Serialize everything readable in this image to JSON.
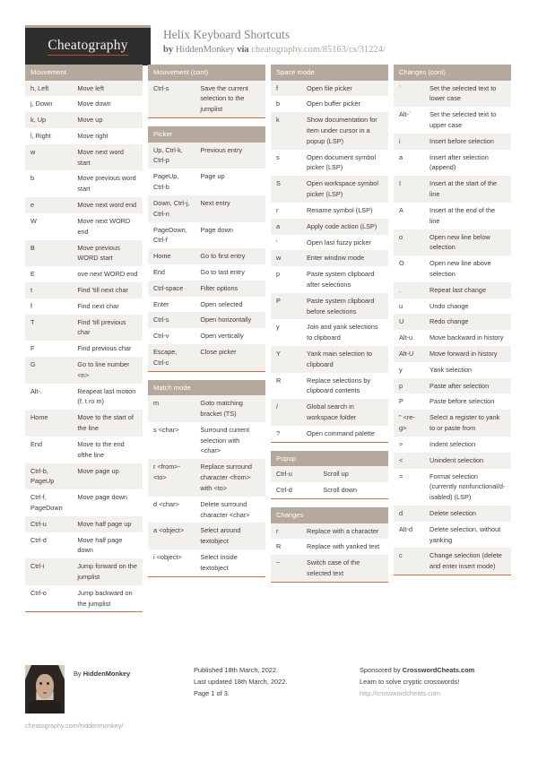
{
  "header": {
    "logo_text": "Cheatography",
    "title": "Helix Keyboard Shortcuts",
    "by_label": "by",
    "author": "HiddenMonkey",
    "via_label": "via",
    "source_url": "cheatography.com/85163/cs/31224/"
  },
  "columns": [
    {
      "blocks": [
        {
          "title": "Mouvement",
          "narrow_key": false,
          "rows": [
            [
              "h, Left",
              "Move left"
            ],
            [
              "j, Down",
              "Move down"
            ],
            [
              "k, Up",
              "Move up"
            ],
            [
              "l, Right",
              "Move right"
            ],
            [
              "w",
              "Move next word start"
            ],
            [
              "b",
              "Move previous word start"
            ],
            [
              "e",
              "Move next word end"
            ],
            [
              "W",
              "Move next WORD end"
            ],
            [
              "B",
              "Move previous WORD start"
            ],
            [
              "E",
              "ove next WORD end"
            ],
            [
              "t",
              "Find 'till next char"
            ],
            [
              "f",
              "Find next char"
            ],
            [
              "T",
              "Find 'till previous char"
            ],
            [
              "F",
              "Find previous char"
            ],
            [
              "G",
              "Go to line number <n>"
            ],
            [
              "Alt-.",
              "Reapeat last motion (f, t ro m)"
            ],
            [
              "Home",
              "Move to the start of the line"
            ],
            [
              "End",
              "Move to the end ofthe line"
            ],
            [
              "Ctrl-b, PageUp",
              "Move page up"
            ],
            [
              "Ctrl-f, PageDown",
              "Move page down"
            ],
            [
              "Ctrl-u",
              "Move half page up"
            ],
            [
              "Ctrl-d",
              "Move half page down"
            ],
            [
              "Ctrl-i",
              "Jump forward on the jumplist"
            ],
            [
              "Ctrl-o",
              "Jump backward on the jumplist"
            ]
          ]
        }
      ]
    },
    {
      "blocks": [
        {
          "title": "Mouvement (cont)",
          "narrow_key": false,
          "rows": [
            [
              "Ctrl-s",
              "Save the current selection to the jumplist"
            ]
          ]
        },
        {
          "title": "Picker",
          "narrow_key": false,
          "rows": [
            [
              "Up, Ctrl-k, Ctrl-p",
              "Previous entry"
            ],
            [
              "PageUp, Ctrl-b",
              "Page up"
            ],
            [
              "Down, Ctrl-j, Ctrl-n",
              "Next entry"
            ],
            [
              "PageDown, Ctrl-f",
              "Page down"
            ],
            [
              "Home",
              "Go to first entry"
            ],
            [
              "End",
              "Go to last entry"
            ],
            [
              "Ctrl-space",
              "Filter options"
            ],
            [
              "Enter",
              "Open selected"
            ],
            [
              "Ctrl-s",
              "Open horizo­ntally"
            ],
            [
              "Ctrl-v",
              "Open vertically"
            ],
            [
              "Escape, Ctrl-c",
              "Close picker"
            ]
          ]
        },
        {
          "title": "Match mode",
          "narrow_key": false,
          "rows": [
            [
              "m",
              "Goto matching bracket (TS)"
            ],
            [
              "s <ch­ar>",
              "Surround current selection with <char>"
            ],
            [
              "r <fr­om>-<to>",
              "Replace surround character <from> with <to>"
            ],
            [
              "d <ch­ar>",
              "Delete surround character <char>"
            ],
            [
              "a <ob­ject>",
              "Select around textobject"
            ],
            [
              "i <ob­ject>",
              "Select inside textobject"
            ]
          ]
        }
      ]
    },
    {
      "blocks": [
        {
          "title": "Space mode",
          "narrow_key": true,
          "rows": [
            [
              "f",
              "Open file picker"
            ],
            [
              "b",
              "Open buffer picker"
            ],
            [
              "k",
              "Show documentation for item under cursor in a popup (LSP)"
            ],
            [
              "s",
              "Open document symbol picker (LSP)"
            ],
            [
              "S",
              "Open workspace symbol picker (LSP)"
            ],
            [
              "r",
              "Rename symbol (LSP)"
            ],
            [
              "a",
              "Apply code action (LSP)"
            ],
            [
              "'",
              "Open last fuzzy picker"
            ],
            [
              "w",
              "Enter window mode"
            ],
            [
              "p",
              "Paste system clipboard after selections"
            ],
            [
              "P",
              "Paste system clipboard before selections"
            ],
            [
              "y",
              "Join and yank selections to clipboard"
            ],
            [
              "Y",
              "Yank main selection to clipboard"
            ],
            [
              "R",
              "Replace selections by clipboard contents"
            ],
            [
              "/",
              "Global search in workspace folder"
            ],
            [
              "?",
              "Open command palette"
            ]
          ]
        },
        {
          "title": "Popup",
          "narrow_key": false,
          "rows": [
            [
              "Ctrl-u",
              "Scroll up"
            ],
            [
              "Ctrl-d",
              "Scroll down"
            ]
          ]
        },
        {
          "title": "Changes",
          "narrow_key": true,
          "rows": [
            [
              "r",
              "Replace with a character"
            ],
            [
              "R",
              "Replace with yanked text"
            ],
            [
              "~",
              "Switch case of the selected text"
            ]
          ]
        }
      ]
    },
    {
      "blocks": [
        {
          "title": "Changes (cont)",
          "narrow_key": true,
          "rows": [
            [
              "`",
              "Set the selected text to lower case"
            ],
            [
              "Alt-`",
              "Set the selected text to upper case"
            ],
            [
              "i",
              "Insert before selection"
            ],
            [
              "a",
              "Insert after selection (append)"
            ],
            [
              "I",
              "Insert at the start of the line"
            ],
            [
              "A",
              "Insert at the end of the line"
            ],
            [
              "o",
              "Open new line below selection"
            ],
            [
              "O",
              "Open new line above selection"
            ],
            [
              ".",
              "Repeat last change"
            ],
            [
              "u",
              "Undo change"
            ],
            [
              "U",
              "Redo change"
            ],
            [
              "Alt-u",
              "Move backward in history"
            ],
            [
              "Alt-U",
              "Move forward in history"
            ],
            [
              "y",
              "Yank selection"
            ],
            [
              "p",
              "Paste after selection"
            ],
            [
              "P",
              "Paste before selection"
            ],
            [
              "\" <re­g>",
              "Select a register to yank to or paste from"
            ],
            [
              ">",
              "Indent selection"
            ],
            [
              "<",
              "Unindent selection"
            ],
            [
              "=",
              "Format selection (currently nonfunctional/d­isabled) (LSP)"
            ],
            [
              "d",
              "Delete selection"
            ],
            [
              "Alt-d",
              "Delete selection, without yanking"
            ],
            [
              "c",
              "Change selection (delete and enter insert mode)"
            ]
          ]
        }
      ]
    }
  ],
  "footer": {
    "by_label": "By ",
    "author": "HiddenMonkey",
    "author_url": "cheatography.com/hiddenmonkey/",
    "published": "Published 18th March, 2022.",
    "updated": "Last updated 18th March, 2022.",
    "page": "Page 1 of 3.",
    "sponsor_prefix": "Sponsored by ",
    "sponsor_name": "CrosswordCheats.com",
    "sponsor_tagline": "Learn to solve cryptic crosswords!",
    "sponsor_url": "http://crosswordcheats.com"
  }
}
